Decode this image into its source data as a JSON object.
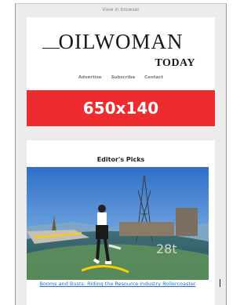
{
  "header": {
    "view_in_browser": "View in browser"
  },
  "logo": {
    "main": "OILWOMAN",
    "sub": "TODAY"
  },
  "nav": {
    "items": [
      "Advertise",
      "Subscribe",
      "Contact"
    ]
  },
  "ad": {
    "label": "650x140",
    "color": "#ee2b2f"
  },
  "picks": {
    "title": "Editor's Picks",
    "caption": "Booms and Busts: Riding the Resource Industry Rollercoaster"
  }
}
